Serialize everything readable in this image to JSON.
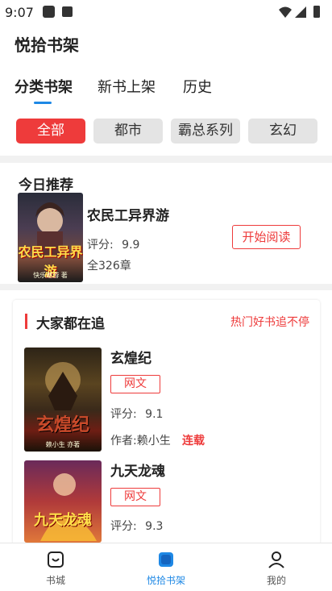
{
  "status_bar": {
    "time": "9:07"
  },
  "app_title": "悦拾书架",
  "tabs": [
    {
      "label": "分类书架",
      "active": true
    },
    {
      "label": "新书上架",
      "active": false
    },
    {
      "label": "历史",
      "active": false
    }
  ],
  "categories": [
    {
      "label": "全部",
      "active": true
    },
    {
      "label": "都市",
      "active": false
    },
    {
      "label": "霸总系列",
      "active": false
    },
    {
      "label": "玄幻",
      "active": false
    }
  ],
  "daily_recommend": {
    "section_title": "今日推荐",
    "book": {
      "cover_title": "农民工异界游",
      "cover_author": "快乐遨游 著",
      "title": "农民工异界游",
      "rating_label": "评分:",
      "rating_value": "9.9",
      "chapters": "全326章",
      "read_button": "开始阅读"
    }
  },
  "popular": {
    "title": "大家都在追",
    "more_link": "热门好书追不停",
    "books": [
      {
        "cover_title": "玄煌纪",
        "cover_author": "赖小生 亦著",
        "title": "玄煌纪",
        "tag": "网文",
        "rating_label": "评分:",
        "rating_value": "9.1",
        "author_label": "作者:赖小生",
        "status": "连载"
      },
      {
        "cover_title": "九天龙魂",
        "cover_author": "",
        "title": "九天龙魂",
        "tag": "网文",
        "rating_label": "评分:",
        "rating_value": "9.3"
      }
    ]
  },
  "bottom_nav": [
    {
      "label": "书城",
      "icon": "bookstore-icon",
      "active": false
    },
    {
      "label": "悦拾书架",
      "icon": "bookshelf-icon",
      "active": true
    },
    {
      "label": "我的",
      "icon": "profile-icon",
      "active": false
    }
  ],
  "colors": {
    "accent_red": "#ee3b3b",
    "accent_blue": "#1e88e5"
  }
}
